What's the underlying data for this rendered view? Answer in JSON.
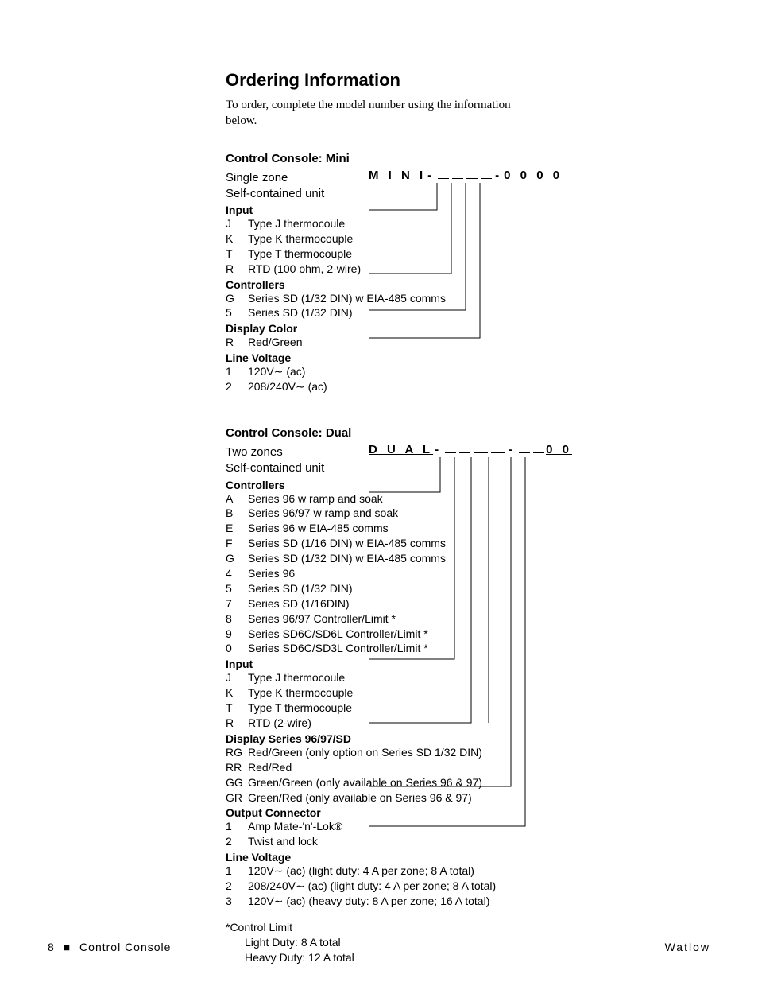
{
  "title": "Ordering Information",
  "intro": "To order, complete the model number using the information below.",
  "mini": {
    "heading": "Control Console: Mini",
    "desc1": "Single zone",
    "desc2": "Self-contained unit",
    "prefix": "M I N I",
    "suffix": "0 0 0 0",
    "groups": [
      {
        "head": "Input",
        "opts": [
          {
            "c": "J",
            "d": "Type J thermocoule"
          },
          {
            "c": "K",
            "d": "Type K thermocouple"
          },
          {
            "c": "T",
            "d": "Type T thermocouple"
          },
          {
            "c": "R",
            "d": "RTD (100 ohm, 2-wire)"
          }
        ]
      },
      {
        "head": "Controllers",
        "opts": [
          {
            "c": "G",
            "d": "Series SD (1/32 DIN) w EIA-485 comms"
          },
          {
            "c": "5",
            "d": "Series SD (1/32 DIN)"
          }
        ]
      },
      {
        "head": "Display Color",
        "opts": [
          {
            "c": "R",
            "d": "Red/Green"
          }
        ]
      },
      {
        "head": "Line Voltage",
        "opts": [
          {
            "c": "1",
            "d": "120V∼ (ac)"
          },
          {
            "c": "2",
            "d": "208/240V∼ (ac)"
          }
        ]
      }
    ]
  },
  "dual": {
    "heading": "Control Console: Dual",
    "desc1": "Two zones",
    "desc2": "Self-contained unit",
    "prefix": "D U A L",
    "suffix": "0 0",
    "groups": [
      {
        "head": "Controllers",
        "opts": [
          {
            "c": "A",
            "d": "Series 96 w ramp and soak"
          },
          {
            "c": "B",
            "d": "Series 96/97 w ramp and soak"
          },
          {
            "c": "E",
            "d": "Series 96 w EIA-485 comms"
          },
          {
            "c": "F",
            "d": "Series SD (1/16 DIN) w EIA-485 comms"
          },
          {
            "c": "G",
            "d": "Series SD (1/32 DIN) w EIA-485 comms"
          },
          {
            "c": "4",
            "d": "Series 96"
          },
          {
            "c": "5",
            "d": "Series SD (1/32 DIN)"
          },
          {
            "c": "7",
            "d": "Series SD (1/16DIN)"
          },
          {
            "c": "8",
            "d": "Series 96/97 Controller/Limit *"
          },
          {
            "c": "9",
            "d": "Series SD6C/SD6L Controller/Limit *"
          },
          {
            "c": "0",
            "d": "Series SD6C/SD3L Controller/Limit *"
          }
        ]
      },
      {
        "head": "Input",
        "opts": [
          {
            "c": "J",
            "d": "Type J thermocoule"
          },
          {
            "c": "K",
            "d": "Type K thermocouple"
          },
          {
            "c": "T",
            "d": "Type T thermocouple"
          },
          {
            "c": "R",
            "d": "RTD (2-wire)"
          }
        ]
      },
      {
        "head": "Display Series 96/97/SD",
        "opts": [
          {
            "c": "RG",
            "d": "Red/Green (only option on Series SD 1/32 DIN)"
          },
          {
            "c": "RR",
            "d": "Red/Red"
          },
          {
            "c": "GG",
            "d": "Green/Green (only available on Series 96 & 97)"
          },
          {
            "c": "GR",
            "d": "Green/Red (only available on Series 96 & 97)"
          }
        ]
      },
      {
        "head": "Output Connector",
        "opts": [
          {
            "c": "1",
            "d": "Amp Mate-'n'-Lok®"
          },
          {
            "c": "2",
            "d": "Twist and lock"
          }
        ]
      },
      {
        "head": "Line Voltage",
        "opts": [
          {
            "c": "1",
            "d": "120V∼ (ac) (light duty: 4 A per zone; 8 A total)"
          },
          {
            "c": "2",
            "d": "208/240V∼ (ac) (light duty: 4 A per zone; 8 A total)"
          },
          {
            "c": "3",
            "d": "120V∼ (ac) (heavy duty: 8 A per zone; 16 A total)"
          }
        ]
      }
    ],
    "note_head": "*Control Limit",
    "note_l1": "Light Duty: 8 A total",
    "note_l2": "Heavy Duty: 12 A total"
  },
  "footer": {
    "page": "8",
    "square": "■",
    "doc": "Control Console",
    "brand": "Watlow"
  }
}
